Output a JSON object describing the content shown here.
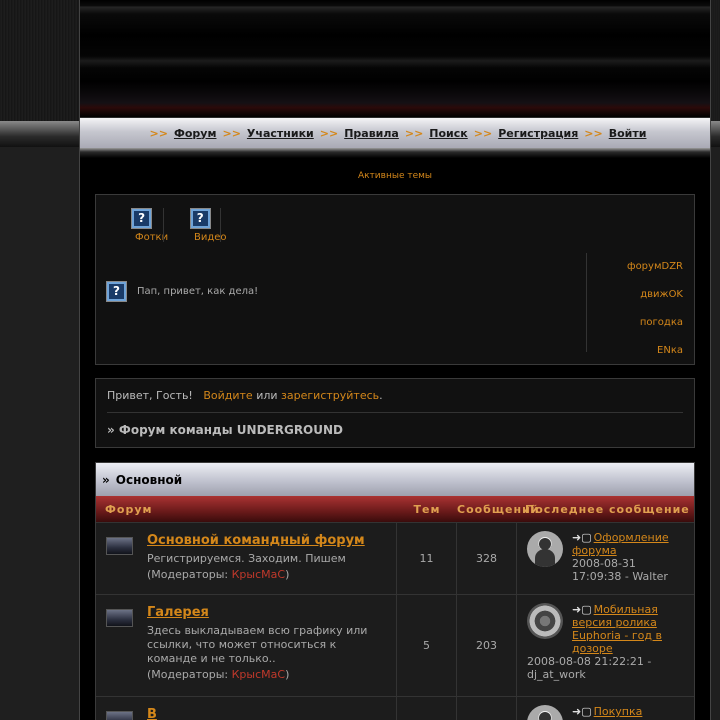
{
  "nav": {
    "items": [
      {
        "label": "Форум"
      },
      {
        "label": "Участники"
      },
      {
        "label": "Правила"
      },
      {
        "label": "Поиск"
      },
      {
        "label": "Регистрация"
      },
      {
        "label": "Войти"
      }
    ],
    "separator": ">>"
  },
  "active_topics": "Активные темы",
  "media": {
    "items": [
      {
        "label": "Фотки",
        "icon": "help-icon"
      },
      {
        "label": "Видео",
        "icon": "help-icon"
      }
    ]
  },
  "greeting": "Пап, привет, как дела!",
  "side_links": [
    "форумDZR",
    "движOK",
    "погодка",
    "ENка"
  ],
  "guest": {
    "hello": "Привет, Гость!",
    "login": "Войдите",
    "or": "или",
    "register": "зарегиструйтесь",
    "dot": "."
  },
  "breadcrumb": "» Форум команды UNDERGROUND",
  "category": {
    "title": "Основной",
    "arrow": "»"
  },
  "columns": {
    "forum": "Форум",
    "topics": "Тем",
    "posts": "Сообщений",
    "last": "Последнее сообщение"
  },
  "forums": [
    {
      "name": "Основной командный форум",
      "desc": "Регистрируемся. Заходим. Пишем",
      "mod_prefix": "(Модераторы: ",
      "moderator": "КрысМаС",
      "mod_suffix": ")",
      "topics": "11",
      "posts": "328",
      "last_topic": "Оформление форума",
      "last_date": "2008-08-31 17:09:38 - Walter"
    },
    {
      "name": "Галерея",
      "desc": "Здесь выкладываем всю графику или ссылки, что может относиться к команде и не только..",
      "mod_prefix": "(Модераторы: ",
      "moderator": "КрысМаС",
      "mod_suffix": ")",
      "topics": "5",
      "posts": "203",
      "last_topic": "Мобильная версия ролика Euphoria - год в дозоре",
      "last_date": "2008-08-08 21:22:21 - dj_at_work"
    },
    {
      "name": "В",
      "last_topic": "Покупка"
    }
  ]
}
